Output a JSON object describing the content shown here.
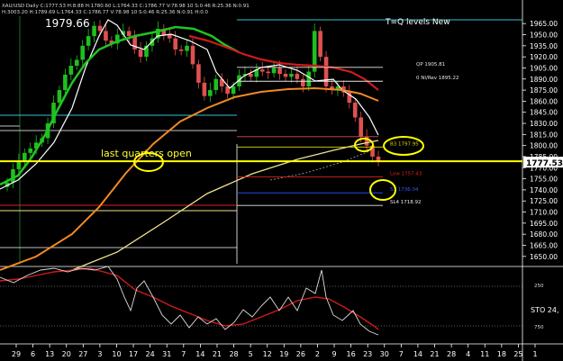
{
  "header": {
    "line1": "XAU/USD Daily C:1777.53 H:8.88 H:1780.60 L:1764.33 C:1786.77 V:78.98 10 S:0.46 R:25.36 N:0.91",
    "line2": "H:3003.20 H:1789.69 L:1764.33 C:1786.77 V:78.98 10 S:0.46 R:25.36 N:0.91 H:0.0",
    "price_label": "1979.66",
    "top_right": "T=Q levels New"
  },
  "price_axis": {
    "ticks": [
      1965.0,
      1950.0,
      1935.0,
      1920.0,
      1905.0,
      1890.0,
      1875.0,
      1860.0,
      1845.0,
      1830.0,
      1815.0,
      1800.0,
      1785.0,
      1770.0,
      1755.0,
      1740.0,
      1725.0,
      1710.0,
      1695.0,
      1680.0,
      1665.0,
      1650.0
    ],
    "current_price": "1777.53"
  },
  "date_axis": {
    "labels": [
      "29",
      "6",
      "13",
      "20",
      "27",
      "3",
      "10",
      "17",
      "24",
      "31",
      "7",
      "14",
      "21",
      "28",
      "5",
      "12",
      "19",
      "26",
      "2",
      "9",
      "16",
      "23",
      "30",
      "7",
      "14",
      "21",
      "28",
      "4",
      "11",
      "18",
      "25",
      "1"
    ]
  },
  "annotations": {
    "main_label": "last quarters open",
    "levels": [
      {
        "text": "QP 1905.81",
        "price": 1905.81,
        "color": "#e8e8e8"
      },
      {
        "text": "0 NI/Rev 1895.22",
        "price": 1887,
        "color": "#e8e8e8"
      },
      {
        "text": "B3 1797.95",
        "price": 1797.95,
        "color": "#e6d800"
      },
      {
        "text": "Low 1757.43",
        "price": 1757.43,
        "color": "#e02020"
      },
      {
        "text": "S3 1736.04",
        "price": 1736.04,
        "color": "#2b5cff"
      },
      {
        "text": "SL4 1718.92",
        "price": 1718.92,
        "color": "#e8e8e8"
      }
    ]
  },
  "oscillator": {
    "label": "STO 24,",
    "ticks": [
      "250",
      "750"
    ]
  },
  "colors": {
    "background": "#000000",
    "up_candle": "#1fbf1f",
    "down_candle": "#e05050",
    "white_ma": "#ffffff",
    "green_ma": "#22c422",
    "red_ma": "#d11a1a",
    "orange_ma": "#f08a24",
    "yellow_ma": "#efe28a",
    "annotation_yellow": "#ffff00",
    "grid_line": "#ffffff"
  },
  "chart_data": {
    "type": "candlestick",
    "instrument": "XAU/USD",
    "timeframe": "Daily",
    "ylim": [
      1640,
      1975
    ],
    "x_label_dates": [
      "29",
      "6",
      "13",
      "20",
      "27",
      "3",
      "10",
      "17",
      "24",
      "31",
      "7",
      "14",
      "21",
      "28",
      "5",
      "12",
      "19",
      "26",
      "2",
      "9",
      "16",
      "23",
      "30",
      "7",
      "14",
      "21",
      "28",
      "4",
      "11",
      "18",
      "25",
      "1"
    ],
    "close_path": [
      1750,
      1768,
      1779,
      1790,
      1796,
      1804,
      1810,
      1830,
      1858,
      1875,
      1896,
      1908,
      1916,
      1935,
      1948,
      1962,
      1955,
      1942,
      1938,
      1950,
      1955,
      1948,
      1930,
      1920,
      1935,
      1945,
      1958,
      1950,
      1945,
      1930,
      1928,
      1935,
      1910,
      1885,
      1867,
      1875,
      1890,
      1880,
      1870,
      1880,
      1895,
      1897,
      1893,
      1903,
      1900,
      1898,
      1905,
      1897,
      1893,
      1897,
      1890,
      1880,
      1900,
      1955,
      1920,
      1880,
      1875,
      1880,
      1872,
      1858,
      1838,
      1812,
      1800,
      1785,
      1778
    ],
    "levels": [
      1905.81,
      1895.22,
      1797.95,
      1777.53,
      1757.43,
      1736.04,
      1718.92
    ]
  }
}
